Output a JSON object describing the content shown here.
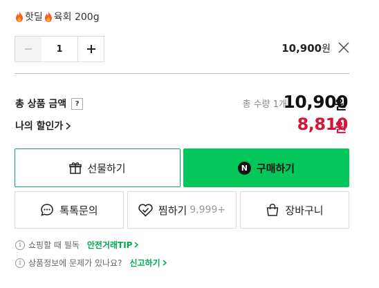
{
  "option": {
    "title_part1": "핫딜",
    "title_part2": "육회 200g",
    "fire_icon": "fire-icon"
  },
  "stepper": {
    "minus_icon": "minus-icon",
    "quantity": "1",
    "plus_icon": "plus-icon"
  },
  "line_item": {
    "price": "10,900",
    "currency": "원",
    "remove_icon": "close-icon"
  },
  "summary": {
    "total_label": "총 상품 금액",
    "help_label": "?",
    "total_qty_label": "총 수량 1개",
    "total_price": "10,900",
    "total_currency": "원",
    "discount_label": "나의 할인가",
    "discount_price": "8,810",
    "discount_currency": "원"
  },
  "actions": {
    "gift_label": "선물하기",
    "buy_label": "구매하기",
    "buy_icon_letter": "N",
    "talk_label": "톡톡문의",
    "wish_label": "찜하기",
    "wish_count": "9,999+",
    "cart_label": "장바구니"
  },
  "notes": {
    "note1_text": "쇼핑할 때 필독",
    "note1_link": "안전거래TIP",
    "note2_text": "상품정보에 문제가 있나요?",
    "note2_link": "신고하기",
    "info_glyph": "i"
  },
  "colors": {
    "brand_green": "#03c75a",
    "discount_red": "#d4153a"
  }
}
